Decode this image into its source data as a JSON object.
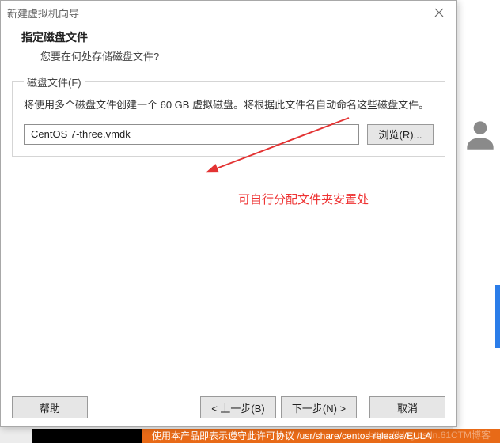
{
  "dialog": {
    "title": "新建虚拟机向导",
    "header_title": "指定磁盘文件",
    "header_sub": "您要在何处存储磁盘文件?"
  },
  "diskfile": {
    "legend": "磁盘文件(F)",
    "description": "将使用多个磁盘文件创建一个 60 GB 虚拟磁盘。将根据此文件名自动命名这些磁盘文件。",
    "value": "CentOS 7-three.vmdk",
    "browse_label": "浏览(R)..."
  },
  "annotation": {
    "text": "可自行分配文件夹安置处",
    "color": "#e33333"
  },
  "buttons": {
    "help": "帮助",
    "back": "< 上一步(B)",
    "next": "下一步(N) >",
    "cancel": "取消"
  },
  "background": {
    "orange_text": "使用本产品即表示遵守此许可协议 /usr/share/centos-release/EULA",
    "watermark": "https://blog.csdn.61CTM博客"
  }
}
